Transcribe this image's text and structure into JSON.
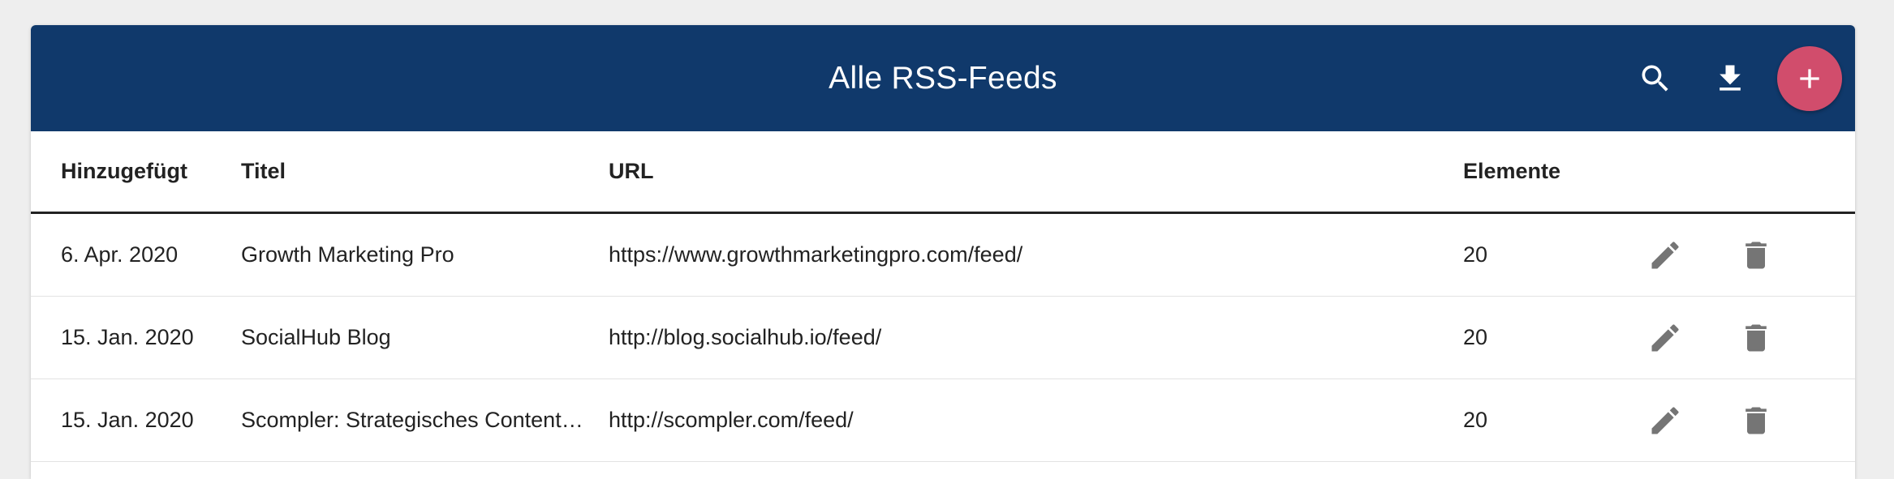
{
  "header": {
    "title": "Alle RSS-Feeds",
    "background_color": "#10396b",
    "actions": [
      {
        "icon": "search-icon"
      },
      {
        "icon": "download-icon"
      },
      {
        "icon": "plus-icon",
        "color": "#d14d6c"
      }
    ]
  },
  "table": {
    "columns": [
      "Hinzugefügt",
      "Titel",
      "URL",
      "Elemente"
    ],
    "rows": [
      {
        "added": "6. Apr. 2020",
        "title": "Growth Marketing Pro",
        "url": "https://www.growthmarketingpro.com/feed/",
        "elements": "20"
      },
      {
        "added": "15. Jan. 2020",
        "title": "SocialHub Blog",
        "url": "http://blog.socialhub.io/feed/",
        "elements": "20"
      },
      {
        "added": "15. Jan. 2020",
        "title": "Scompler: Strategisches Content…",
        "url": "http://scompler.com/feed/",
        "elements": "20"
      }
    ],
    "row_actions": [
      "edit-icon",
      "delete-icon"
    ]
  }
}
